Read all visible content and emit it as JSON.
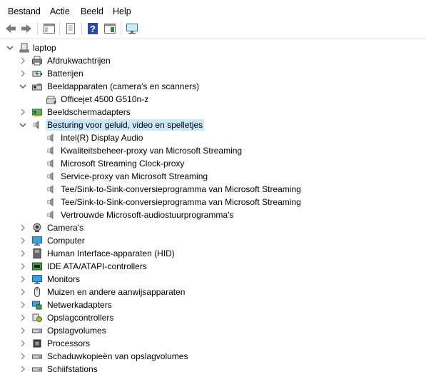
{
  "menubar": {
    "items": [
      "Bestand",
      "Actie",
      "Beeld",
      "Help"
    ]
  },
  "toolbar": {
    "buttons": [
      "back-icon",
      "forward-icon",
      "show-hide-console-tree-icon",
      "properties-icon",
      "help-icon",
      "action-pane-icon",
      "monitor-icon"
    ]
  },
  "colors": {
    "selection": "#cce8ff",
    "chevron": "#7a7a7a"
  },
  "tree": {
    "root": "laptop",
    "rows": [
      {
        "label": "laptop",
        "icon": "computer-icon",
        "expanded": true
      },
      {
        "label": "Afdrukwachtrijen",
        "icon": "printer-icon",
        "expanded": false
      },
      {
        "label": "Batterijen",
        "icon": "battery-icon",
        "expanded": false
      },
      {
        "label": "Beeldapparaten (camera's en scanners)",
        "icon": "scanner-icon",
        "expanded": true
      },
      {
        "label": "Officejet 4500 G510n-z",
        "icon": "scanner-device-icon"
      },
      {
        "label": "Beeldschermadapters",
        "icon": "display-adapter-icon",
        "expanded": false
      },
      {
        "label": "Besturing voor geluid, video en spelletjes",
        "icon": "speaker-icon",
        "expanded": true,
        "selected": true
      },
      {
        "label": "Intel(R) Display Audio",
        "icon": "speaker-icon"
      },
      {
        "label": "Kwaliteitsbeheer-proxy van Microsoft Streaming",
        "icon": "speaker-icon"
      },
      {
        "label": "Microsoft Streaming Clock-proxy",
        "icon": "speaker-icon"
      },
      {
        "label": "Service-proxy van Microsoft Streaming",
        "icon": "speaker-icon"
      },
      {
        "label": "Tee/Sink-to-Sink-conversieprogramma van Microsoft Streaming",
        "icon": "speaker-icon"
      },
      {
        "label": "Tee/Sink-to-Sink-conversieprogramma van Microsoft Streaming",
        "icon": "speaker-icon"
      },
      {
        "label": "Vertrouwde Microsoft-audiostuurprogramma's",
        "icon": "speaker-icon"
      },
      {
        "label": "Camera's",
        "icon": "camera-icon",
        "expanded": false
      },
      {
        "label": "Computer",
        "icon": "monitor-icon",
        "expanded": false
      },
      {
        "label": "Human Interface-apparaten (HID)",
        "icon": "hid-icon",
        "expanded": false
      },
      {
        "label": "IDE ATA/ATAPI-controllers",
        "icon": "ide-controller-icon",
        "expanded": false
      },
      {
        "label": "Monitors",
        "icon": "monitor-icon",
        "expanded": false
      },
      {
        "label": "Muizen en andere aanwijsapparaten",
        "icon": "mouse-icon",
        "expanded": false
      },
      {
        "label": "Netwerkadapters",
        "icon": "network-adapter-icon",
        "expanded": false
      },
      {
        "label": "Opslagcontrollers",
        "icon": "storage-controller-icon",
        "expanded": false
      },
      {
        "label": "Opslagvolumes",
        "icon": "drive-icon",
        "expanded": false
      },
      {
        "label": "Processors",
        "icon": "processor-icon",
        "expanded": false
      },
      {
        "label": "Schaduwkopieën van opslagvolumes",
        "icon": "drive-icon",
        "expanded": false
      },
      {
        "label": "Schijfstations",
        "icon": "drive-icon",
        "expanded": false
      }
    ]
  }
}
